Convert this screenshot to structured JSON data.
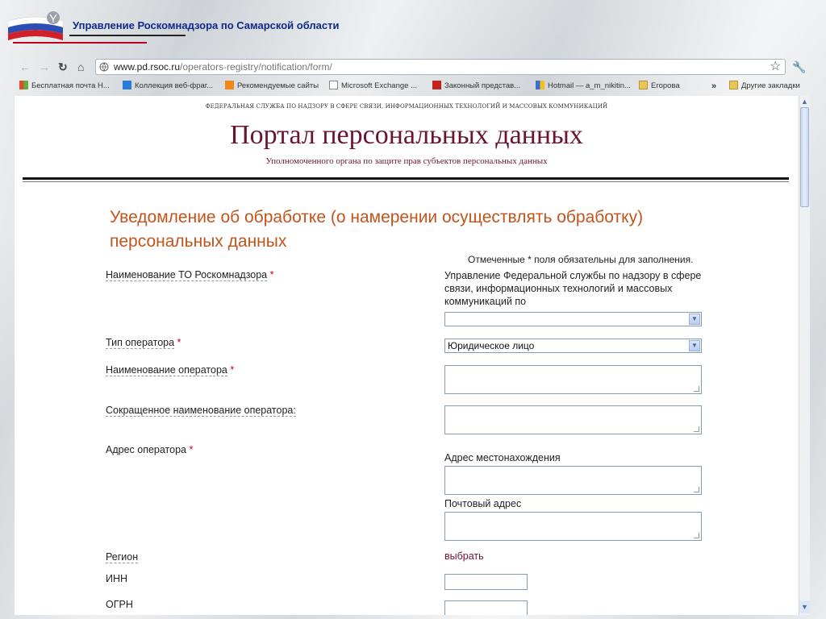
{
  "slide": {
    "title": "Управление Роскомнадзора по Самарской области"
  },
  "browser": {
    "url_host": "www.pd.rsoc.ru",
    "url_path": "/operators-registry/notification/form/",
    "bookmarks": [
      {
        "label": "Бесплатная почта Н...",
        "icon_color": "#3a6fd0"
      },
      {
        "label": "Коллекция веб-фраг...",
        "icon_color": "#2a7ad8"
      },
      {
        "label": "Рекомендуемые сайты",
        "icon_color": "#f08a16"
      },
      {
        "label": "Microsoft Exchange ...",
        "icon_color": "#ffffff"
      },
      {
        "label": "Законный представ...",
        "icon_color": "#c4231c"
      },
      {
        "label": "Hotmail — a_m_nikitin...",
        "icon_color": "#3a6fd0"
      },
      {
        "label": "Егорова",
        "icon_color": "#e9c65c"
      }
    ],
    "overflow_label": "»",
    "other_bookmarks": "Другие закладки"
  },
  "page": {
    "agency_caption": "ФЕДЕРАЛЬНАЯ СЛУЖБА ПО НАДЗОРУ В СФЕРЕ СВЯЗИ, ИНФОРМАЦИОННЫХ ТЕХНОЛОГИЙ И МАССОВЫХ КОММУНИКАЦИЙ",
    "portal_title": "Портал персональных данных",
    "portal_subtitle": "Уполномоченного органа по защите прав субъектов персональных данных",
    "form_title": "Уведомление об обработке (о намерении осуществлять обработку) персональных данных",
    "required_note": "Отмеченные * поля обязательны для заполнения.",
    "required_mark": "*"
  },
  "form": {
    "to_label": "Наименование ТО Роскомнадзора",
    "to_value": "Управление Федеральной службы по надзору в сфере связи, информационных технологий и массовых коммуникаций по",
    "to_select_value": "",
    "operator_type_label": "Тип оператора",
    "operator_type_value": "Юридическое лицо",
    "operator_name_label": "Наименование оператора",
    "operator_short_label": "Сокращенное наименование оператора:",
    "address_label": "Адрес оператора",
    "location_address_label": "Адрес местонахождения",
    "postal_address_label": "Почтовый адрес",
    "region_label": "Регион",
    "region_link": "выбрать",
    "inn_label": "ИНН",
    "ogrn_label": "ОГРН"
  },
  "colors": {
    "portal_maroon": "#6b1430",
    "form_title_orange": "#c2541c",
    "required_red": "#c0001a",
    "slide_title_blue": "#0d2a8a"
  }
}
